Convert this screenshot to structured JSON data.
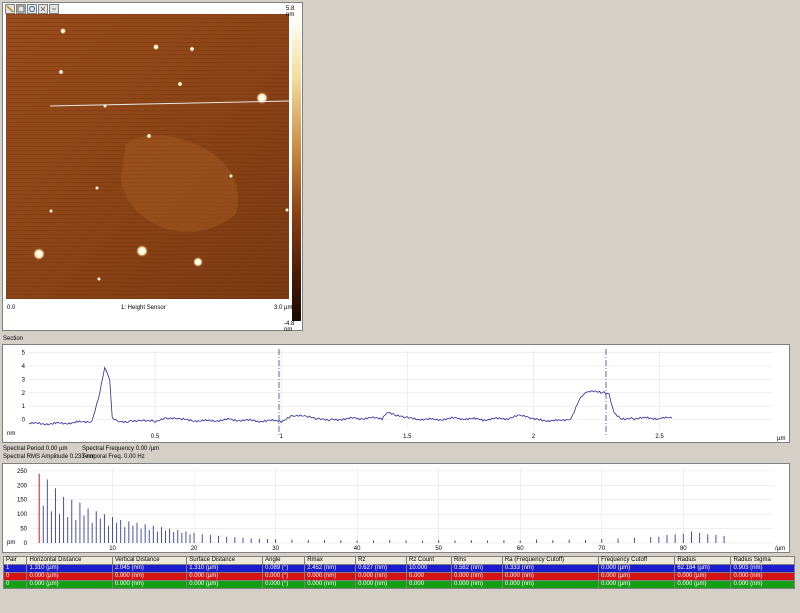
{
  "image_panel": {
    "scale_top": "5.8 nm",
    "scale_bottom": "-4.8 nm",
    "axis_start": "0.0",
    "axis_end": "3.0 µm",
    "channel_label": "1: Height Sensor",
    "tools": [
      "pointer-icon",
      "zoom-icon",
      "crosshair-icon",
      "minus-icon"
    ]
  },
  "section": {
    "title": "Section",
    "y_unit": "nm",
    "x_unit": "µm",
    "y_ticks": [
      "5",
      "4",
      "3",
      "2",
      "1",
      "0"
    ],
    "x_ticks": [
      "0.5",
      "1",
      "1.5",
      "2",
      "2.5"
    ]
  },
  "spectral": {
    "period": "Spectral Period 0.00 µm",
    "frequency": "Spectral Frequency 0.00 /µm",
    "rms": "Spectral RMS Amplitude 0.233 nm",
    "temporal": "Temporal Freq. 0.00 Hz"
  },
  "spectrum": {
    "y_unit": "pm",
    "x_unit": "/µm",
    "y_ticks": [
      "250",
      "200",
      "150",
      "100",
      "50",
      "0"
    ],
    "x_ticks": [
      "10",
      "20",
      "30",
      "40",
      "50",
      "60",
      "70",
      "80"
    ]
  },
  "table": {
    "headers": [
      "Pair",
      "Horizontal Distance",
      "Vertical Distance",
      "Surface Distance",
      "Angle",
      "Rmax",
      "Rz",
      "Rz Count",
      "Rms",
      "Ra (Frequency Cutoff)",
      "Frequency Cutoff",
      "Radius",
      "Radius Sigma"
    ],
    "rows": [
      [
        "1",
        "1.310 (µm)",
        "2.045 (nm)",
        "1.310 (µm)",
        "0.089 (°)",
        "2.452 (nm)",
        "0.627 (nm)",
        "10.000",
        "0.582 (nm)",
        "0.333 (nm)",
        "0.000 (µm)",
        "62.184 (µm)",
        "0.903 (nm)"
      ],
      [
        "0",
        "0.000 (µm)",
        "0.000 (nm)",
        "0.000 (µm)",
        "0.000 (°)",
        "0.000 (nm)",
        "0.000 (nm)",
        "0.000",
        "0.000 (nm)",
        "0.000 (nm)",
        "0.000 (µm)",
        "0.000 (µm)",
        "0.000 (nm)"
      ],
      [
        "0",
        "0.000 (µm)",
        "0.000 (nm)",
        "0.000 (µm)",
        "0.000 (°)",
        "0.000 (nm)",
        "0.000 (nm)",
        "0.000",
        "0.000 (nm)",
        "0.000 (nm)",
        "0.000 (µm)",
        "0.000 (µm)",
        "0.000 (nm)"
      ]
    ]
  },
  "chart_data": [
    {
      "type": "line",
      "xlabel": "µm",
      "ylabel": "nm",
      "xlim": [
        0,
        2.95
      ],
      "ylim": [
        -0.7,
        5.2
      ],
      "series": [
        {
          "x": [
            0,
            0.1,
            0.2,
            0.25,
            0.28,
            0.3,
            0.32,
            0.33,
            0.35,
            0.4,
            0.45,
            0.5,
            0.55,
            0.6,
            0.7,
            0.8,
            0.9,
            1.0,
            1.05,
            1.1,
            1.15,
            1.2,
            1.3,
            1.4,
            1.42,
            1.45,
            1.5,
            1.6,
            1.7,
            1.8,
            1.9,
            1.95,
            2.0,
            2.1,
            2.15,
            2.18,
            2.2,
            2.22,
            2.28,
            2.3,
            2.32,
            2.35,
            2.4,
            2.5,
            2.55
          ],
          "y": [
            -0.3,
            -0.3,
            -0.2,
            -0.1,
            2.0,
            4.0,
            3.0,
            0.1,
            -0.2,
            -0.1,
            0.0,
            -0.1,
            0.1,
            0.0,
            -0.1,
            0.0,
            -0.1,
            -0.1,
            0.3,
            0.2,
            0.0,
            0.0,
            0.1,
            0.1,
            0.6,
            0.3,
            0.1,
            0.0,
            0.1,
            0.0,
            0.1,
            0.3,
            0.0,
            -0.1,
            0.1,
            1.5,
            2.0,
            2.1,
            2.0,
            1.8,
            0.5,
            0.1,
            0.1,
            0.1,
            0.1
          ]
        }
      ]
    },
    {
      "type": "bar",
      "xlabel": "/µm",
      "ylabel": "pm",
      "xlim": [
        0,
        91
      ],
      "ylim": [
        0,
        260
      ],
      "x": [
        1,
        1.5,
        2,
        2.5,
        3,
        3.5,
        4,
        4.5,
        5,
        5.5,
        6,
        6.5,
        7,
        7.5,
        8,
        8.5,
        9,
        9.5,
        10,
        10.5,
        11,
        11.5,
        12,
        12.5,
        13,
        13.5,
        14,
        14.5,
        15,
        15.5,
        16,
        16.5,
        17,
        17.5,
        18,
        18.5,
        19,
        19.5,
        20,
        21,
        22,
        23,
        24,
        25,
        26,
        27,
        28,
        29,
        30,
        32,
        34,
        36,
        38,
        40,
        42,
        44,
        46,
        48,
        50,
        52,
        54,
        56,
        58,
        60,
        62,
        64,
        66,
        68,
        70,
        72,
        74,
        76,
        77,
        78,
        79,
        80,
        81,
        82,
        83,
        84,
        85
      ],
      "values": [
        240,
        130,
        220,
        110,
        190,
        100,
        160,
        90,
        150,
        80,
        140,
        95,
        120,
        70,
        110,
        85,
        100,
        60,
        90,
        70,
        80,
        55,
        75,
        60,
        70,
        50,
        65,
        45,
        60,
        40,
        55,
        42,
        50,
        38,
        45,
        35,
        40,
        30,
        35,
        30,
        28,
        25,
        22,
        20,
        18,
        16,
        15,
        14,
        13,
        12,
        11,
        10,
        10,
        9,
        9,
        10,
        9,
        8,
        10,
        9,
        10,
        9,
        10,
        9,
        12,
        10,
        12,
        10,
        14,
        15,
        18,
        20,
        22,
        28,
        30,
        32,
        40,
        35,
        30,
        28,
        25
      ]
    }
  ]
}
